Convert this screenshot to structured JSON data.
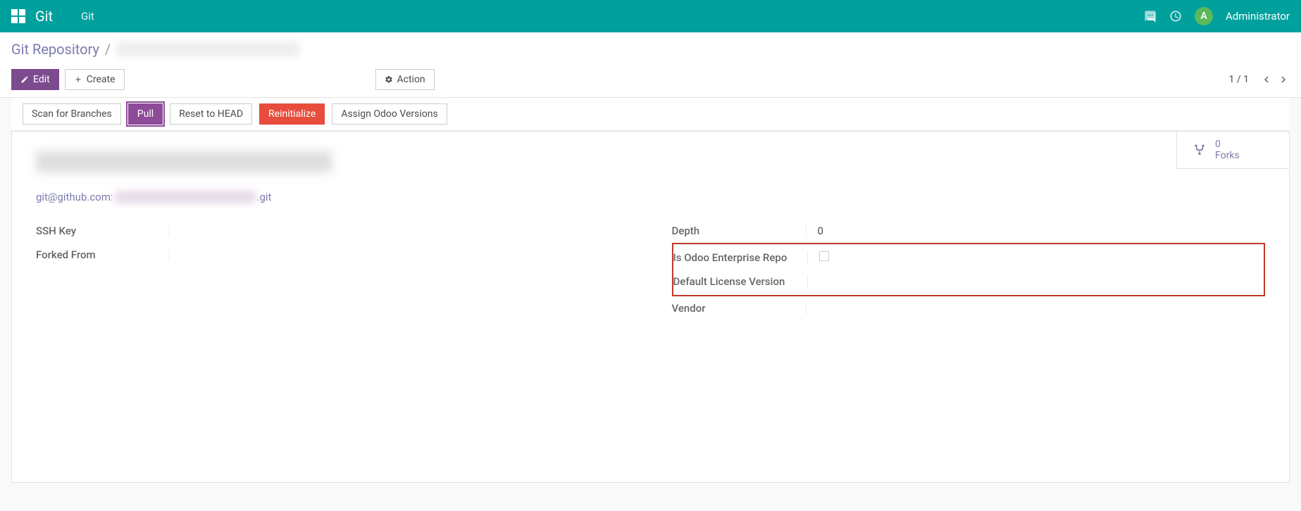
{
  "navbar": {
    "brand": "Git",
    "menu_item": "Git",
    "user": {
      "initial": "A",
      "name": "Administrator"
    }
  },
  "breadcrumb": {
    "root": "Git Repository",
    "separator": "/"
  },
  "toolbar": {
    "edit": "Edit",
    "create": "Create",
    "action": "Action"
  },
  "pager": {
    "text": "1 / 1"
  },
  "actions": {
    "scan": "Scan for Branches",
    "pull": "Pull",
    "reset": "Reset to HEAD",
    "reinit": "Reinitialize",
    "assign": "Assign Odoo Versions"
  },
  "stat": {
    "count": "0",
    "label": "Forks"
  },
  "uri": {
    "prefix": "git@github.com:",
    "suffix": ".git"
  },
  "fields": {
    "ssh_key_label": "SSH Key",
    "forked_from_label": "Forked From",
    "depth_label": "Depth",
    "depth_value": "0",
    "is_enterprise_label": "Is Odoo Enterprise Repo",
    "license_label": "Default License Version",
    "vendor_label": "Vendor"
  }
}
